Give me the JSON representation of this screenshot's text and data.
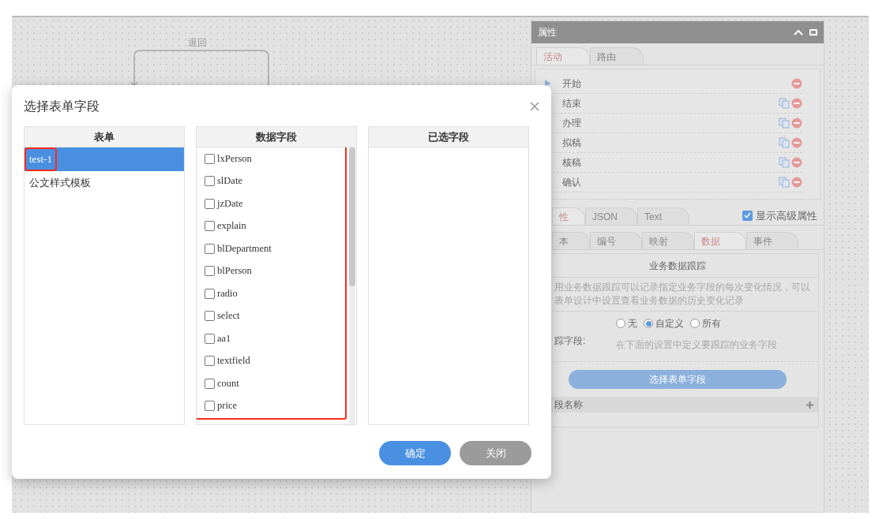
{
  "canvas": {
    "flow_label": "退回"
  },
  "properties_panel": {
    "title": "属性",
    "tabs": [
      {
        "label": "活动",
        "selected": true
      },
      {
        "label": "路由",
        "selected": false
      }
    ],
    "activities": [
      {
        "label": "开始",
        "kind": "start"
      },
      {
        "label": "结束",
        "kind": "task"
      },
      {
        "label": "办理",
        "kind": "task"
      },
      {
        "label": "拟稿",
        "kind": "task"
      },
      {
        "label": "核稿",
        "kind": "task"
      },
      {
        "label": "确认",
        "kind": "task"
      }
    ],
    "view_tabs": [
      {
        "label": "性",
        "selected": true
      },
      {
        "label": "JSON",
        "selected": false
      },
      {
        "label": "Text",
        "selected": false
      }
    ],
    "advanced": {
      "label": "显示高级属性",
      "checked": true
    },
    "detail_tabs": [
      {
        "label": "本",
        "selected": false
      },
      {
        "label": "编号",
        "selected": false
      },
      {
        "label": "映射",
        "selected": false
      },
      {
        "label": "数据",
        "selected": true
      },
      {
        "label": "事件",
        "selected": false
      }
    ],
    "section": {
      "title": "业务数据跟踪",
      "description_lines": [
        "用业务数据跟踪可以记录指定业务字段的每次变化情况，可以",
        "表单设计中设置查看业务数据的历史变化记录"
      ],
      "track_label": "踪字段:",
      "options": [
        {
          "label": "无",
          "selected": false
        },
        {
          "label": "自定义",
          "selected": true
        },
        {
          "label": "所有",
          "selected": false
        }
      ],
      "hint": "在下面的设置中定义要跟踪的业务字段",
      "button": "选择表单字段",
      "column": "段名称"
    }
  },
  "dialog": {
    "title": "选择表单字段",
    "forms": {
      "heading": "表单",
      "items": [
        {
          "label": "test-1",
          "selected": true,
          "highlighted": true
        },
        {
          "label": "公文样式模板",
          "selected": false,
          "highlighted": false
        }
      ]
    },
    "fields": {
      "heading": "数据字段",
      "highlighted": true,
      "items": [
        {
          "label": "lxPerson",
          "checked": false
        },
        {
          "label": "slDate",
          "checked": false
        },
        {
          "label": "jzDate",
          "checked": false
        },
        {
          "label": "explain",
          "checked": false
        },
        {
          "label": "blDepartment",
          "checked": false
        },
        {
          "label": "blPerson",
          "checked": false
        },
        {
          "label": "radio",
          "checked": false
        },
        {
          "label": "select",
          "checked": false
        },
        {
          "label": "aa1",
          "checked": false
        },
        {
          "label": "textfield",
          "checked": false
        },
        {
          "label": "count",
          "checked": false
        },
        {
          "label": "price",
          "checked": false
        }
      ]
    },
    "chosen": {
      "heading": "已选字段"
    },
    "buttons": [
      {
        "label": "确定",
        "kind": "primary"
      },
      {
        "label": "关闭",
        "kind": "secondary"
      }
    ]
  }
}
